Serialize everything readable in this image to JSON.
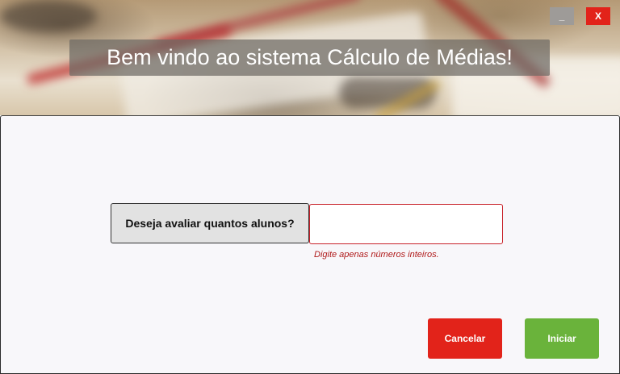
{
  "header": {
    "title": "Bem vindo ao sistema Cálculo de Médias!",
    "minimize_label": "_",
    "close_label": "X"
  },
  "form": {
    "question": "Deseja avaliar quantos alunos?",
    "input_value": "",
    "hint": "Digite apenas números inteiros."
  },
  "actions": {
    "cancel_label": "Cancelar",
    "start_label": "Iniciar"
  },
  "colors": {
    "cancel": "#e2231a",
    "start": "#6ab33b",
    "close": "#e2231a",
    "minimize": "#9e9b98",
    "hint": "#b01b1b"
  }
}
